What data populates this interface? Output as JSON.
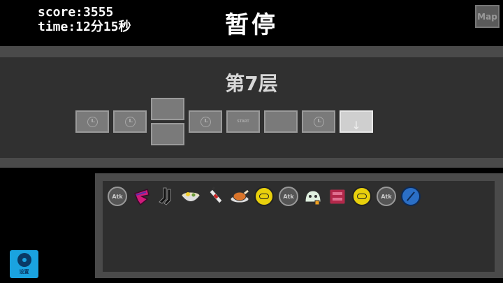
{
  "hud": {
    "score": "score:3555",
    "time": "time:12分15秒"
  },
  "title": "暂停",
  "map_button": "Map",
  "floor_label": "第7层",
  "rooms": [
    {
      "type": "clock-icon"
    },
    {
      "type": "clock-icon"
    },
    {
      "type": "empty"
    },
    {
      "type": "empty"
    },
    {
      "type": "clock-icon"
    },
    {
      "type": "start",
      "label": "START"
    },
    {
      "type": "empty"
    },
    {
      "type": "clock-icon"
    },
    {
      "type": "current",
      "icon": "down-arrow-icon"
    }
  ],
  "inventory": [
    {
      "icon": "attack-token-icon",
      "label": "Atk"
    },
    {
      "icon": "pink-wing-icon"
    },
    {
      "icon": "black-socks-icon"
    },
    {
      "icon": "noodle-bowl-icon"
    },
    {
      "icon": "bottle-icon"
    },
    {
      "icon": "roast-chicken-icon"
    },
    {
      "icon": "gold-coin-icon"
    },
    {
      "icon": "attack-token-icon",
      "label": "Atk"
    },
    {
      "icon": "ghost-creature-icon"
    },
    {
      "icon": "red-book-icon"
    },
    {
      "icon": "gold-coin-icon"
    },
    {
      "icon": "attack-token-icon",
      "label": "Atk"
    },
    {
      "icon": "blue-shield-icon"
    }
  ],
  "settings_button": "设置",
  "colors": {
    "panel": "#303030",
    "band": "#4a4a4a",
    "settings": "#1aa3e0",
    "coin": "#e8d00c"
  }
}
